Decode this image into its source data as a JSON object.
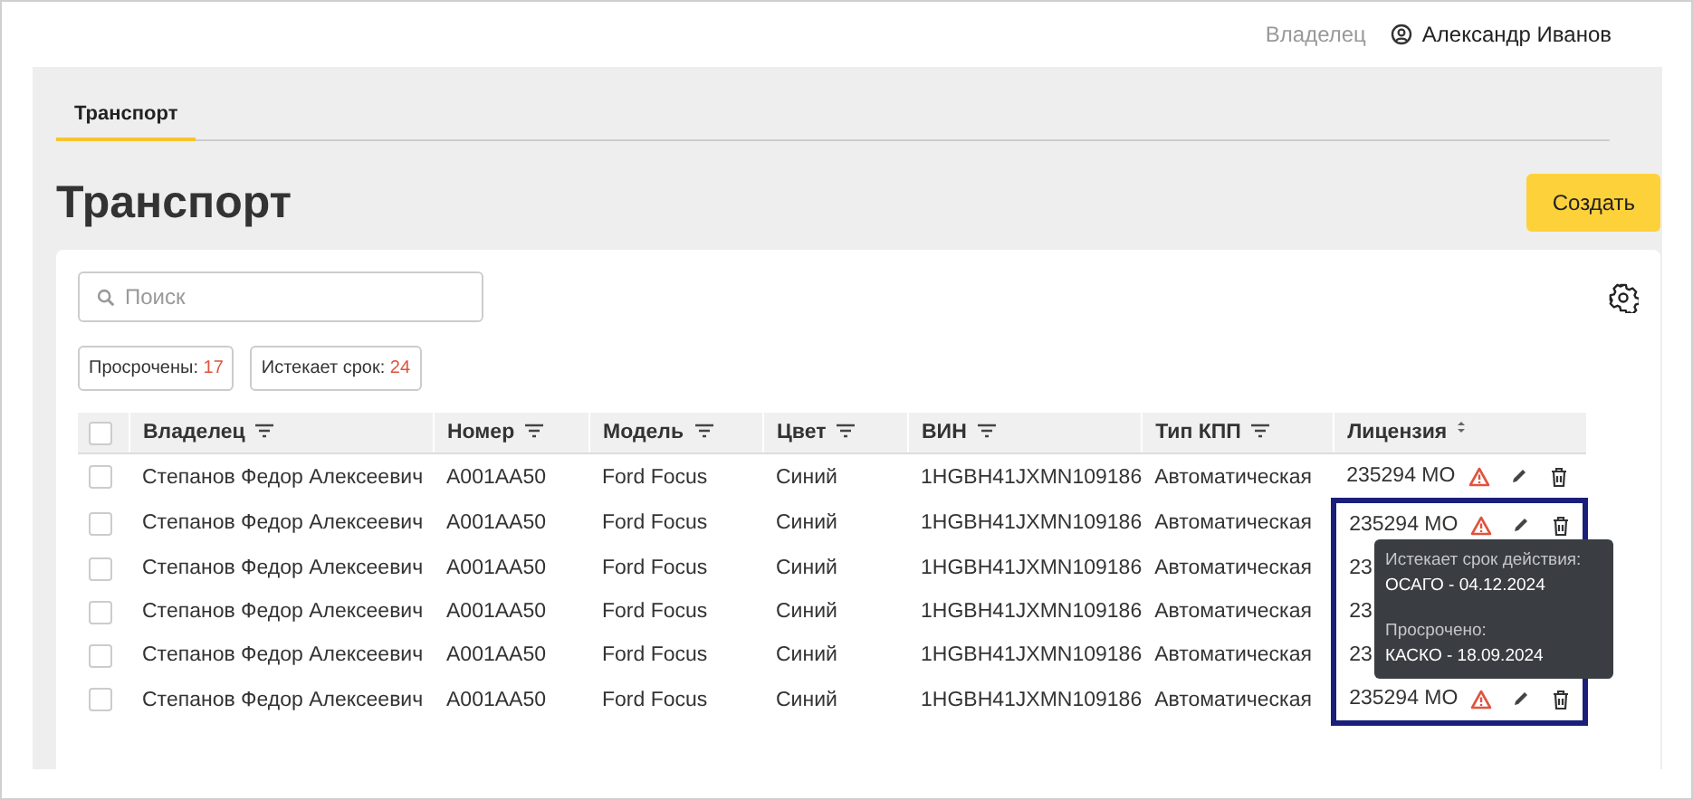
{
  "header": {
    "role": "Владелец",
    "user": "Александр Иванов"
  },
  "tabs": [
    {
      "label": "Транспорт",
      "selected": true
    }
  ],
  "page_title": "Транспорт",
  "create_button": "Создать",
  "search": {
    "placeholder": "Поиск"
  },
  "chips": [
    {
      "label": "Просрочены:",
      "count": "17"
    },
    {
      "label": "Истекает срок:",
      "count": "24"
    }
  ],
  "table": {
    "columns": [
      {
        "label": "Владелец",
        "kind": "filter"
      },
      {
        "label": "Номер",
        "kind": "filter"
      },
      {
        "label": "Модель",
        "kind": "filter"
      },
      {
        "label": "Цвет",
        "kind": "filter"
      },
      {
        "label": "ВИН",
        "kind": "filter"
      },
      {
        "label": "Тип КПП",
        "kind": "filter"
      },
      {
        "label": "Лицензия",
        "kind": "sort"
      }
    ],
    "select_all_checked": false,
    "rows": [
      {
        "checked": false,
        "cells": [
          "Степанов Федор Алексеевич",
          "A001AA50",
          "Ford Focus",
          "Синий",
          "1HGBH41JXMN109186",
          "Автоматическая"
        ],
        "license": "235294 MO",
        "actions": true,
        "highlighted": false
      },
      {
        "checked": false,
        "cells": [
          "Степанов Федор Алексеевич",
          "A001AA50",
          "Ford Focus",
          "Синий",
          "1HGBH41JXMN109186",
          "Автоматическая"
        ],
        "license": "235294 MO",
        "actions": true,
        "highlighted": true
      },
      {
        "checked": false,
        "cells": [
          "Степанов Федор Алексеевич",
          "A001AA50",
          "Ford Focus",
          "Синий",
          "1HGBH41JXMN109186",
          "Автоматическая"
        ],
        "license": "23",
        "actions": false,
        "highlighted": true
      },
      {
        "checked": false,
        "cells": [
          "Степанов Федор Алексеевич",
          "A001AA50",
          "Ford Focus",
          "Синий",
          "1HGBH41JXMN109186",
          "Автоматическая"
        ],
        "license": "23",
        "actions": false,
        "highlighted": true
      },
      {
        "checked": false,
        "cells": [
          "Степанов Федор Алексеевич",
          "A001AA50",
          "Ford Focus",
          "Синий",
          "1HGBH41JXMN109186",
          "Автоматическая"
        ],
        "license": "23",
        "actions": false,
        "highlighted": true
      },
      {
        "checked": false,
        "cells": [
          "Степанов Федор Алексеевич",
          "A001AA50",
          "Ford Focus",
          "Синий",
          "1HGBH41JXMN109186",
          "Автоматическая"
        ],
        "license": "235294 MO",
        "actions": true,
        "highlighted": true
      }
    ]
  },
  "tooltip": [
    {
      "heading": "Истекает срок действия:",
      "item": "ОСАГО - 04.12.2024"
    },
    {
      "heading": "Просрочено:",
      "item": "КАСКО - 18.09.2024"
    }
  ]
}
